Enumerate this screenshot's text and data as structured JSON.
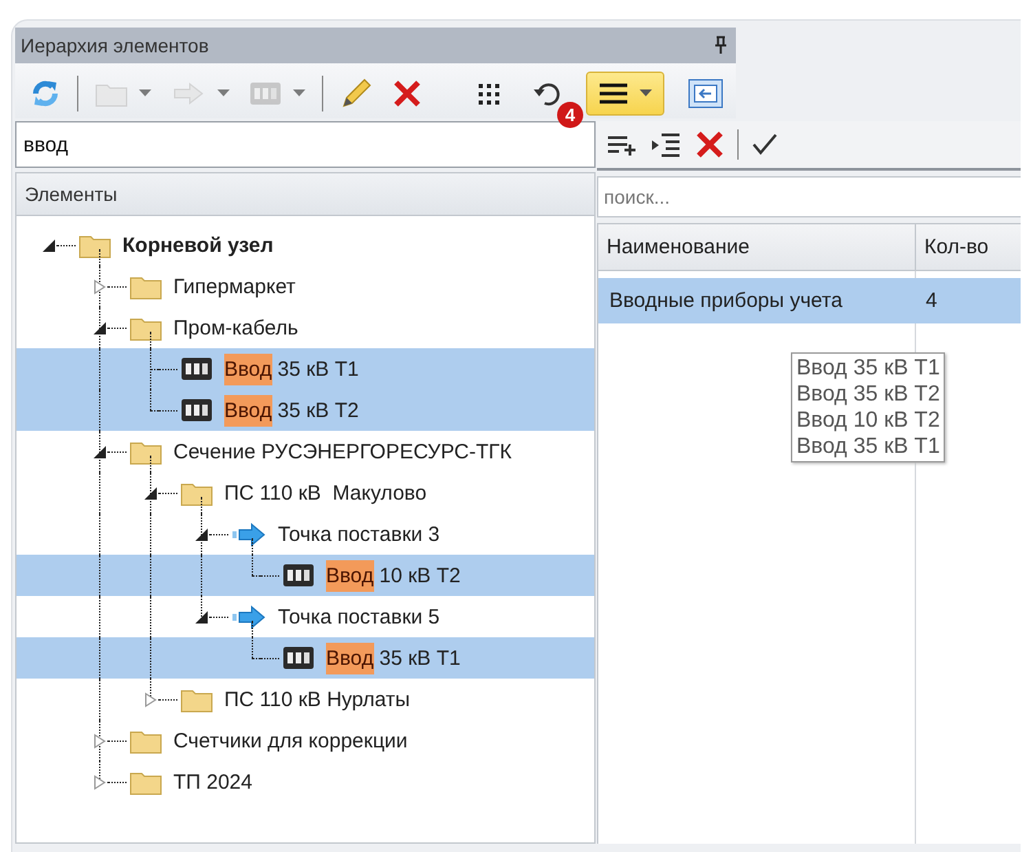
{
  "panel": {
    "title": "Иерархия элементов"
  },
  "toolbar": {
    "left": [
      {
        "kind": "refresh",
        "disabled": false,
        "dropdown": false,
        "pressed": false
      },
      {
        "kind": "separator"
      },
      {
        "kind": "folder",
        "disabled": true,
        "dropdown": true,
        "pressed": false
      },
      {
        "kind": "arrow",
        "disabled": true,
        "dropdown": true,
        "pressed": false
      },
      {
        "kind": "meter",
        "disabled": true,
        "dropdown": true,
        "pressed": false
      },
      {
        "kind": "separator"
      },
      {
        "kind": "pencil",
        "disabled": false,
        "dropdown": false,
        "pressed": false
      },
      {
        "kind": "delete",
        "disabled": false,
        "dropdown": false,
        "pressed": false
      }
    ],
    "right": [
      {
        "kind": "grid",
        "disabled": false,
        "dropdown": false,
        "pressed": false
      },
      {
        "kind": "undo",
        "disabled": false,
        "dropdown": false,
        "pressed": false,
        "badge": "4"
      },
      {
        "kind": "menu",
        "disabled": false,
        "dropdown": true,
        "pressed": true
      },
      {
        "kind": "window",
        "disabled": false,
        "dropdown": false,
        "pressed": false
      }
    ]
  },
  "search": {
    "value": "ввод"
  },
  "tree": {
    "header": "Элементы",
    "nodes": [
      {
        "kind": "folder",
        "label": "Корневой узел",
        "expanded": true,
        "selected": false,
        "children": [
          {
            "kind": "folder",
            "label": "Гипермаркет",
            "expanded": false,
            "selected": false
          },
          {
            "kind": "folder",
            "label": "Пром-кабель",
            "expanded": true,
            "selected": false,
            "children": [
              {
                "kind": "meter",
                "match": "Ввод",
                "label": " 35 кВ Т1",
                "selected": true
              },
              {
                "kind": "meter",
                "match": "Ввод",
                "label": " 35 кВ Т2",
                "selected": true
              }
            ]
          },
          {
            "kind": "folder",
            "label": "Сечение РУСЭНЕРГОРЕСУРС-ТГК",
            "expanded": true,
            "selected": false,
            "children": [
              {
                "kind": "folder",
                "label": "ПС 110 кВ  Макулово",
                "expanded": true,
                "selected": false,
                "children": [
                  {
                    "kind": "point",
                    "label": "Точка поставки 3",
                    "expanded": true,
                    "selected": false,
                    "children": [
                      {
                        "kind": "meter",
                        "match": "Ввод",
                        "label": " 10 кВ Т2",
                        "selected": true
                      }
                    ]
                  },
                  {
                    "kind": "point",
                    "label": "Точка поставки 5",
                    "expanded": true,
                    "selected": false,
                    "children": [
                      {
                        "kind": "meter",
                        "match": "Ввод",
                        "label": " 35 кВ Т1",
                        "selected": true
                      }
                    ]
                  }
                ]
              },
              {
                "kind": "folder",
                "label": "ПС 110 кВ Нурлаты",
                "expanded": false,
                "selected": false
              }
            ]
          },
          {
            "kind": "folder",
            "label": "Счетчики для коррекции",
            "expanded": false,
            "selected": false
          },
          {
            "kind": "folder",
            "label": "ТП 2024",
            "expanded": false,
            "selected": false
          }
        ]
      }
    ]
  },
  "details": {
    "toolbar": [
      {
        "kind": "add-row"
      },
      {
        "kind": "indent"
      },
      {
        "kind": "delete"
      },
      {
        "kind": "separator"
      },
      {
        "kind": "apply"
      }
    ],
    "search": {
      "placeholder": "поиск..."
    },
    "table": {
      "columns": [
        "Наименование",
        "Кол-во"
      ],
      "rows": [
        {
          "cells": [
            "Вводные приборы учета",
            "4"
          ],
          "selected": true
        }
      ]
    },
    "tooltip": {
      "lines": [
        "Ввод 35 кВ Т1",
        "Ввод 35 кВ Т2",
        "Ввод 10 кВ Т2",
        "Ввод 35 кВ Т1"
      ]
    }
  }
}
